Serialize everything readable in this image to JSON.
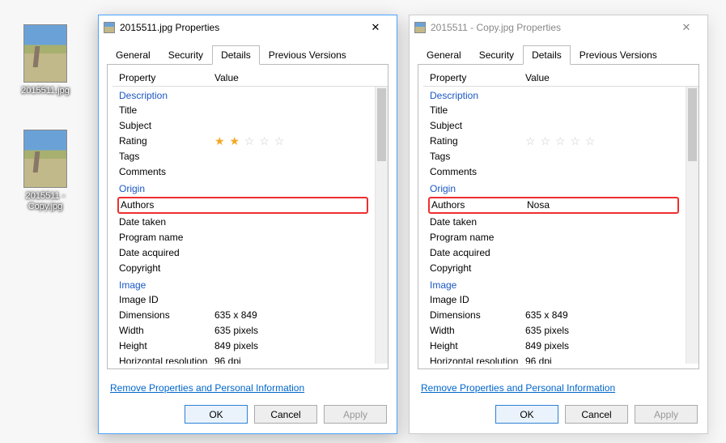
{
  "desktop": {
    "icons": [
      {
        "label": "2015511.jpg"
      },
      {
        "label": "2015511 - Copy.jpg"
      }
    ]
  },
  "dialogs": [
    {
      "active": true,
      "title": "2015511.jpg Properties",
      "tabs": [
        "General",
        "Security",
        "Details",
        "Previous Versions"
      ],
      "active_tab": "Details",
      "headers": {
        "property": "Property",
        "value": "Value"
      },
      "sections": {
        "description": {
          "heading": "Description",
          "rows": [
            {
              "p": "Title",
              "v": ""
            },
            {
              "p": "Subject",
              "v": ""
            },
            {
              "p": "Rating",
              "v": "",
              "stars": 2
            },
            {
              "p": "Tags",
              "v": ""
            },
            {
              "p": "Comments",
              "v": ""
            }
          ]
        },
        "origin": {
          "heading": "Origin",
          "rows": [
            {
              "p": "Authors",
              "v": "",
              "highlight": true
            },
            {
              "p": "Date taken",
              "v": ""
            },
            {
              "p": "Program name",
              "v": ""
            },
            {
              "p": "Date acquired",
              "v": ""
            },
            {
              "p": "Copyright",
              "v": ""
            }
          ]
        },
        "image": {
          "heading": "Image",
          "rows": [
            {
              "p": "Image ID",
              "v": ""
            },
            {
              "p": "Dimensions",
              "v": "635 x 849"
            },
            {
              "p": "Width",
              "v": "635 pixels"
            },
            {
              "p": "Height",
              "v": "849 pixels"
            },
            {
              "p": "Horizontal resolution",
              "v": "96 dpi"
            }
          ]
        }
      },
      "remove_link": "Remove Properties and Personal Information",
      "buttons": {
        "ok": "OK",
        "cancel": "Cancel",
        "apply": "Apply"
      }
    },
    {
      "active": false,
      "title": "2015511 - Copy.jpg Properties",
      "tabs": [
        "General",
        "Security",
        "Details",
        "Previous Versions"
      ],
      "active_tab": "Details",
      "headers": {
        "property": "Property",
        "value": "Value"
      },
      "sections": {
        "description": {
          "heading": "Description",
          "rows": [
            {
              "p": "Title",
              "v": ""
            },
            {
              "p": "Subject",
              "v": ""
            },
            {
              "p": "Rating",
              "v": "",
              "stars": 0
            },
            {
              "p": "Tags",
              "v": ""
            },
            {
              "p": "Comments",
              "v": ""
            }
          ]
        },
        "origin": {
          "heading": "Origin",
          "rows": [
            {
              "p": "Authors",
              "v": "Nosa",
              "highlight": true
            },
            {
              "p": "Date taken",
              "v": ""
            },
            {
              "p": "Program name",
              "v": ""
            },
            {
              "p": "Date acquired",
              "v": ""
            },
            {
              "p": "Copyright",
              "v": ""
            }
          ]
        },
        "image": {
          "heading": "Image",
          "rows": [
            {
              "p": "Image ID",
              "v": ""
            },
            {
              "p": "Dimensions",
              "v": "635 x 849"
            },
            {
              "p": "Width",
              "v": "635 pixels"
            },
            {
              "p": "Height",
              "v": "849 pixels"
            },
            {
              "p": "Horizontal resolution",
              "v": "96 dpi"
            }
          ]
        }
      },
      "remove_link": "Remove Properties and Personal Information",
      "buttons": {
        "ok": "OK",
        "cancel": "Cancel",
        "apply": "Apply"
      }
    }
  ]
}
